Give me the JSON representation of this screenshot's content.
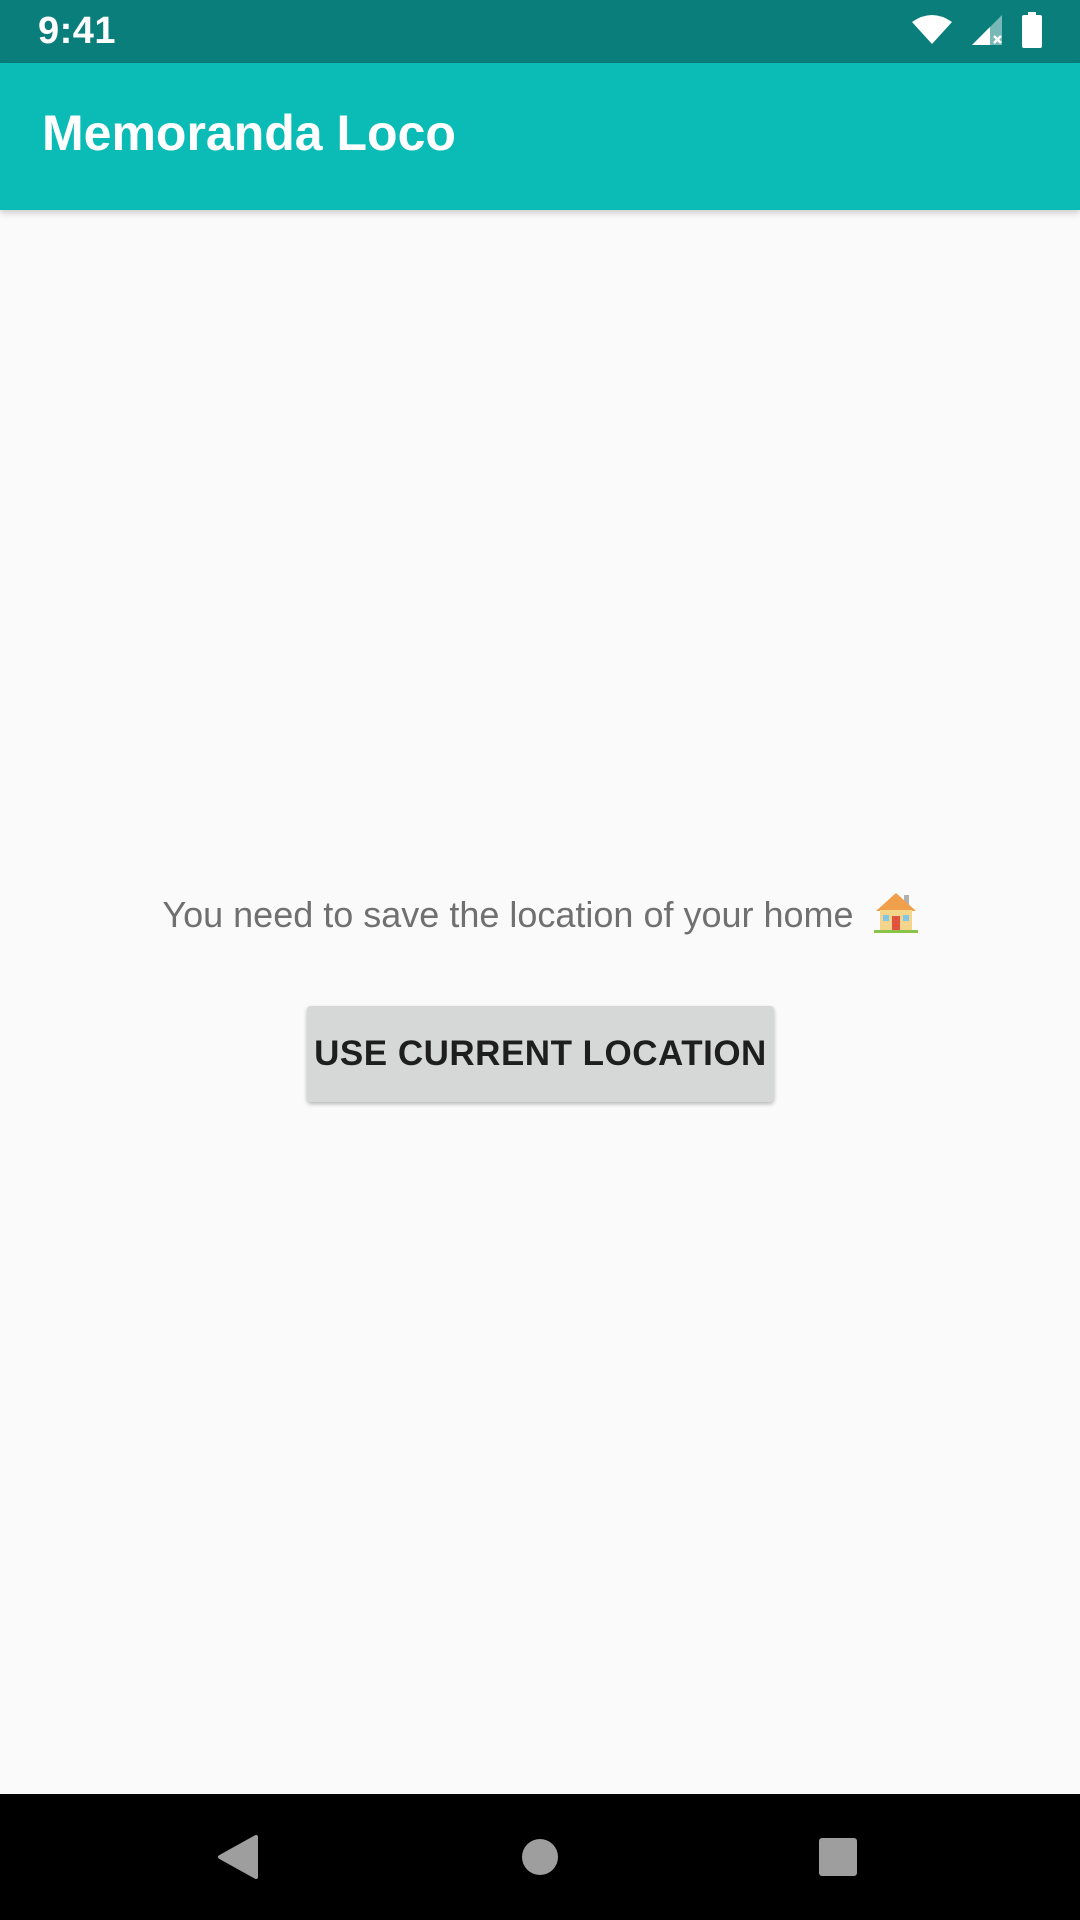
{
  "status_bar": {
    "time": "9:41",
    "icons": [
      "wifi-icon",
      "cell-signal-icon",
      "battery-icon"
    ]
  },
  "app_bar": {
    "title": "Memoranda Loco",
    "color": "#0bbbb5"
  },
  "main": {
    "message": "You need to save the location of your home",
    "message_icon": "house-icon",
    "button_label": "USE CURRENT LOCATION"
  },
  "nav_bar": {
    "items": [
      "back-icon",
      "home-icon",
      "recents-icon"
    ]
  },
  "colors": {
    "status_bar": "#0a7e7b",
    "app_bar": "#0bbbb5",
    "background": "#fafafa",
    "button": "#d6d7d7"
  }
}
